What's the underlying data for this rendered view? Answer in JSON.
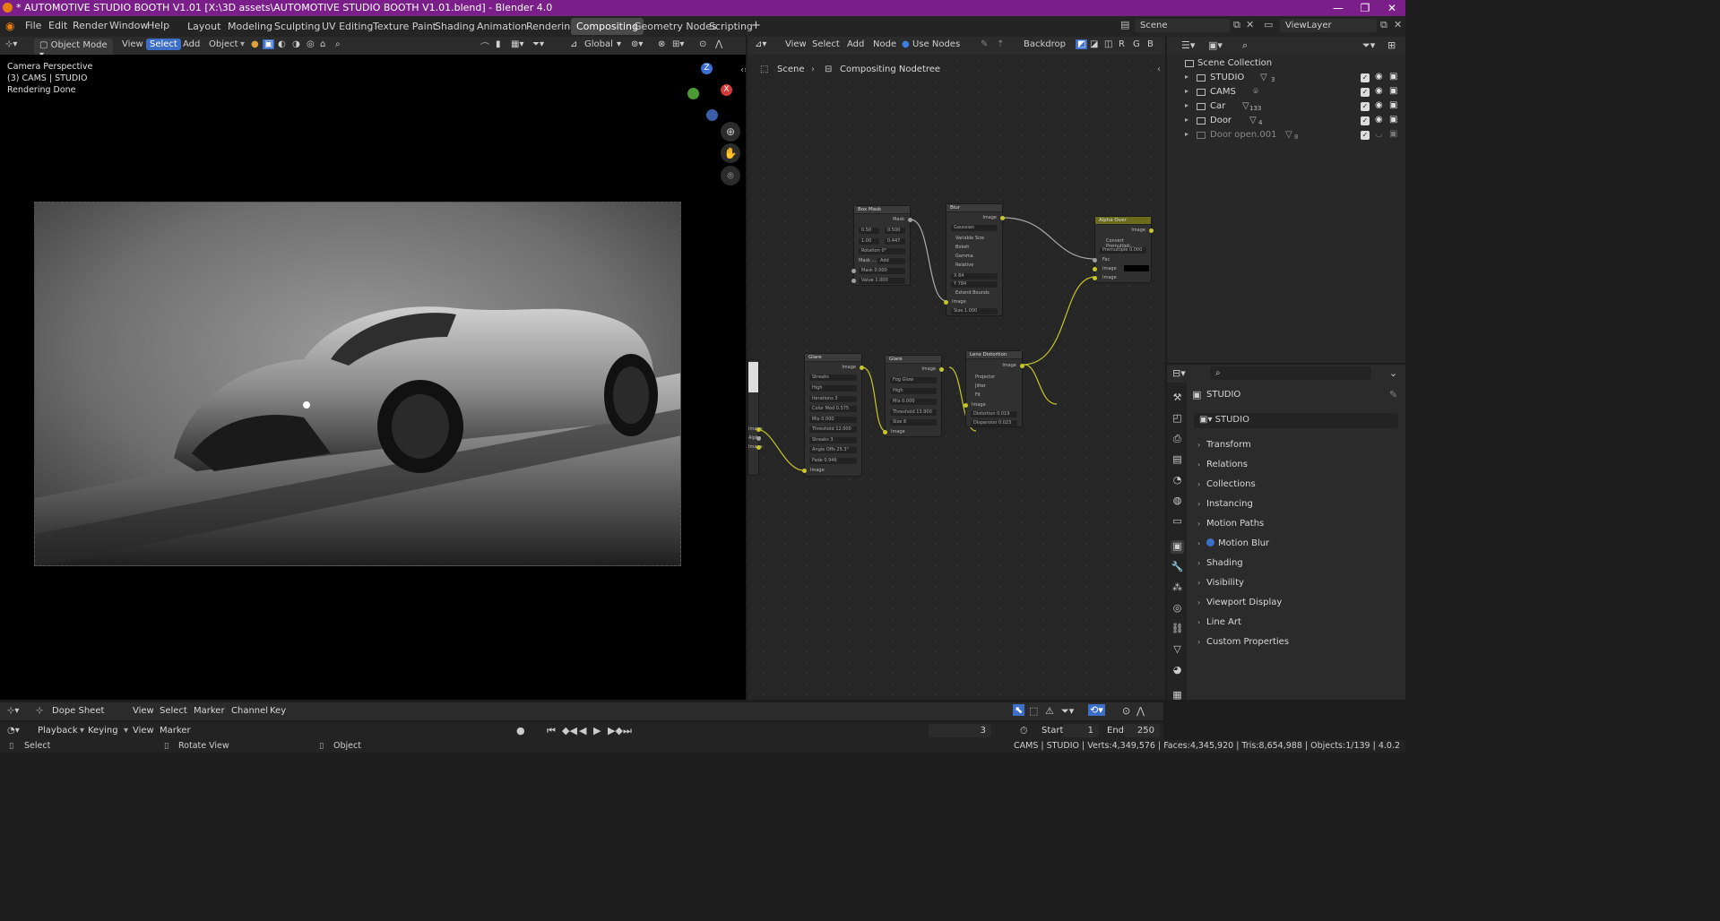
{
  "window": {
    "title": "* AUTOMOTIVE STUDIO BOOTH V1.01 [X:\\3D assets\\AUTOMOTIVE STUDIO BOOTH V1.01.blend] - Blender 4.0",
    "minimize": "—",
    "maximize": "❐",
    "close": "✕"
  },
  "menu": [
    "File",
    "Edit",
    "Render",
    "Window",
    "Help"
  ],
  "workspaces": [
    "Layout",
    "Modeling",
    "Sculpting",
    "UV Editing",
    "Texture Paint",
    "Shading",
    "Animation",
    "Rendering",
    "Compositing",
    "Geometry Nodes",
    "Scripting"
  ],
  "active_workspace": "Compositing",
  "add_workspace": "+",
  "scene_name": "Scene",
  "view_layer": "ViewLayer",
  "viewport": {
    "mode": "Object Mode",
    "menus": [
      "View",
      "Select",
      "Add",
      "Object"
    ],
    "transform_orientation": "Global",
    "info": [
      "Camera Perspective",
      "(3) CAMS | STUDIO",
      "Rendering Done"
    ],
    "gizmo": {
      "z": "Z",
      "x": "X"
    }
  },
  "node_editor": {
    "menus": [
      "View",
      "Select",
      "Add",
      "Node"
    ],
    "use_nodes": "Use Nodes",
    "backdrop": "Backdrop",
    "channels": [
      "R",
      "G",
      "B"
    ],
    "breadcrumb_scene": "Scene",
    "breadcrumb_tree": "Compositing Nodetree",
    "nodes": {
      "box_mask": {
        "title": "Box Mask",
        "out": "Mask",
        "f1a": "0.50",
        "f1b": "0.500",
        "f2a": "1.00",
        "f2b": "0.447",
        "rotation": "Rotation",
        "rotation_val": "0°",
        "mask_type": "Mask ...",
        "mask_mode": "Add",
        "mask": "Mask",
        "mask_val": "0.000",
        "value": "Value",
        "value_val": "1.000"
      },
      "blur": {
        "title": "Blur",
        "out": "Image",
        "type": "Gaussian",
        "opts": [
          "Variable Size",
          "Bokeh",
          "Gamma",
          "Relative"
        ],
        "x": "X",
        "x_val": "84",
        "y": "Y",
        "y_val": "784",
        "extend": "Extend Bounds",
        "in_image": "Image",
        "size": "Size",
        "size_val": "1.000"
      },
      "alpha_over": {
        "title": "Alpha Over",
        "out": "Image",
        "convert": "Convert Premultipli...",
        "premult": "Premultiple",
        "premult_val": "0.000",
        "fac": "Fac",
        "image1": "Image",
        "image2": "Image"
      },
      "glare1": {
        "title": "Glare",
        "out": "Image",
        "type": "Streaks",
        "quality": "High",
        "iterations": "Iterations",
        "iterations_val": "3",
        "color_mod": "Color Mod",
        "color_mod_val": "0.575",
        "mix": "Mix",
        "mix_val": "0.000",
        "threshold": "Threshold",
        "threshold_val": "12.000",
        "streaks": "Streaks",
        "streaks_val": "3",
        "angle": "Angle Offs",
        "angle_val": "25.3°",
        "fade": "Fade",
        "fade_val": "0.946",
        "in_image": "Image"
      },
      "glare2": {
        "title": "Glare",
        "out": "Image",
        "type": "Fog Glow",
        "quality": "High",
        "mix": "Mix",
        "mix_val": "0.000",
        "threshold": "Threshold",
        "threshold_val": "13.900",
        "size": "Size",
        "size_val": "8",
        "in_image": "Image"
      },
      "lens": {
        "title": "Lens Distortion",
        "out": "Image",
        "opts": [
          "Projector",
          "Jitter",
          "Fit"
        ],
        "in_image": "Image",
        "distortion": "Distortion",
        "distortion_val": "0.019",
        "dispersion": "Dispersion",
        "dispersion_val": "0.023"
      },
      "render_layers": {
        "outs": [
          "Image",
          "Alpha",
          "Image"
        ]
      }
    }
  },
  "outliner": {
    "root": "Scene Collection",
    "items": [
      {
        "name": "STUDIO",
        "count": "3"
      },
      {
        "name": "CAMS",
        "count": ""
      },
      {
        "name": "Car",
        "count": "133"
      },
      {
        "name": "Door",
        "count": "4"
      },
      {
        "name": "Door open.001",
        "count": "8"
      }
    ]
  },
  "properties": {
    "object_name": "STUDIO",
    "object_field": "STUDIO",
    "panels": [
      "Transform",
      "Relations",
      "Collections",
      "Instancing",
      "Motion Paths",
      "Motion Blur",
      "Shading",
      "Visibility",
      "Viewport Display",
      "Line Art",
      "Custom Properties"
    ]
  },
  "timeline": {
    "editor": "Dope Sheet",
    "menus": [
      "View",
      "Select",
      "Marker",
      "Channel",
      "Key"
    ],
    "playback": "Playback",
    "keying": "Keying",
    "view": "View",
    "marker": "Marker",
    "current_frame": "3",
    "start_label": "Start",
    "start": "1",
    "end_label": "End",
    "end": "250"
  },
  "statusbar": {
    "select": "Select",
    "rotate": "Rotate View",
    "object": "Object",
    "stats": "CAMS | STUDIO | Verts:4,349,576 | Faces:4,345,920 | Tris:8,654,988 | Objects:1/139 | 4.0.2"
  }
}
